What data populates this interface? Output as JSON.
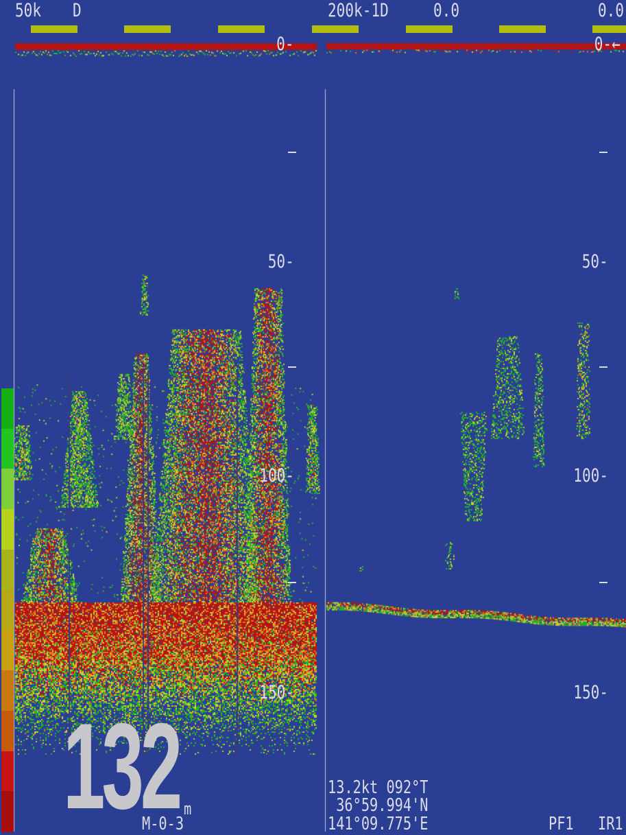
{
  "header": {
    "left_freq": "50k",
    "left_mode": "D",
    "right_freq": "200k-1D",
    "right_value": "0.0",
    "right_value_2": "0.0"
  },
  "left_scale": {
    "zero": "0-",
    "fifty": "50-",
    "hundred": "100-",
    "onefifty": "150-"
  },
  "right_scale": {
    "zero": "0-←",
    "fifty": "50-",
    "hundred": "100-",
    "onefifty": "150-"
  },
  "depth": {
    "value": "132",
    "unit": "m"
  },
  "mode_label": "M-0-3",
  "nav": {
    "speed_heading": "13.2kt 092°T",
    "latitude": " 36°59.994'N",
    "longitude": "141°09.775'E"
  },
  "status": {
    "pf": "PF1",
    "ir": "IR1"
  },
  "colors": {
    "background": "#2a3e94",
    "echo_strong": "#b51414",
    "echo_orange": "#e07820",
    "echo_yellow": "#c8d232",
    "echo_green": "#28b428",
    "gain_bar": "#b2bd10",
    "text": "#dcdce8"
  },
  "palette": [
    "#15b015",
    "#22c422",
    "#7ed03a",
    "#b6d21c",
    "#a8b41a",
    "#b8a818",
    "#c8a012",
    "#c8780e",
    "#c65a0c",
    "#c81414",
    "#a80e0e"
  ]
}
